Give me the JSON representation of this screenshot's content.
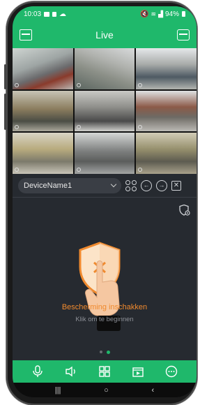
{
  "status": {
    "time": "10:03",
    "battery": "94%"
  },
  "header": {
    "title": "Live"
  },
  "cameras": [
    "cam-1",
    "cam-2",
    "cam-3",
    "cam-4",
    "cam-5",
    "cam-6",
    "cam-7",
    "cam-8",
    "cam-9"
  ],
  "device": {
    "selected": "DeviceName1"
  },
  "protection": {
    "title": "Bescherming inschakken",
    "subtitle": "Klik om te beginnen"
  },
  "pager": {
    "count": 2,
    "active": 1
  },
  "toolbar": {
    "items": [
      "microphone-icon",
      "speaker-icon",
      "layout-grid-icon",
      "recordings-icon",
      "more-icon"
    ]
  },
  "colors": {
    "accent": "#1fb86b",
    "panel": "#262a30",
    "warning": "#f08a2e"
  }
}
